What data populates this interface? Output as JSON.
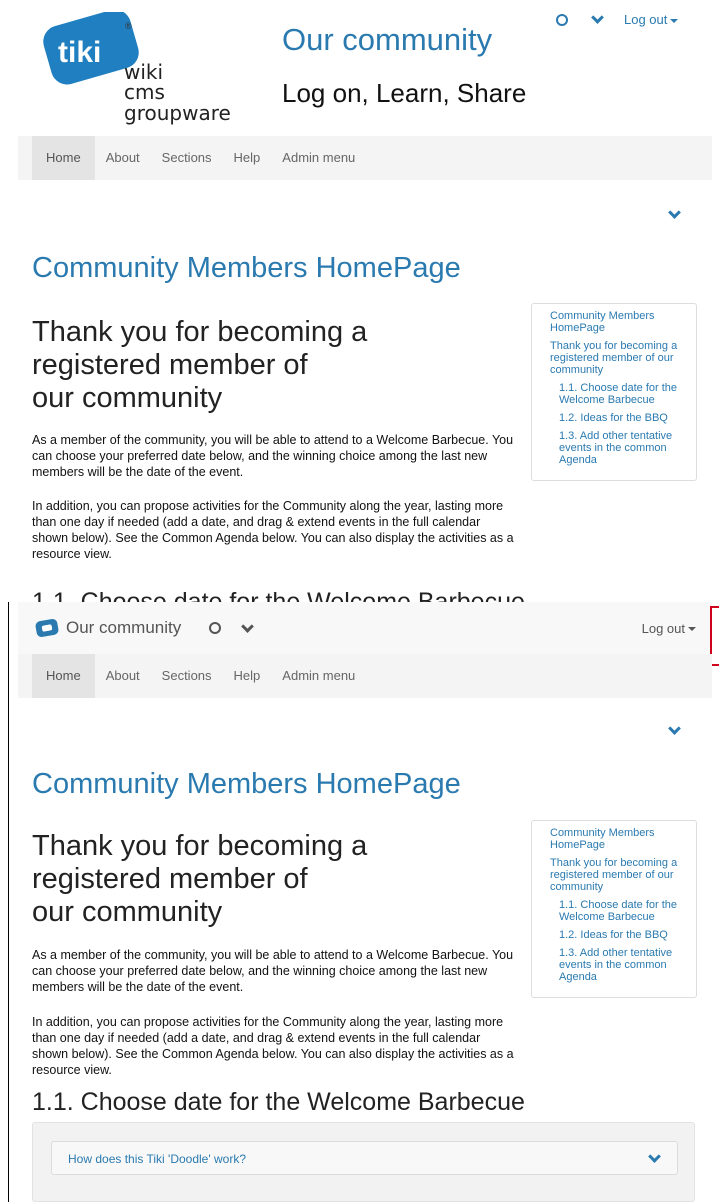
{
  "site": {
    "title": "Our community",
    "slogan": "Log on, Learn, Share",
    "logo": {
      "brand": "tiki",
      "line1": "wiki",
      "line2": "cms",
      "line3": "groupware",
      "mark": "®"
    }
  },
  "topbar": {
    "logout_label": "Log out",
    "icons": [
      "clock-icon",
      "chevron-down-icon",
      "caret-icon"
    ]
  },
  "nav": {
    "items": [
      "Home",
      "About",
      "Sections",
      "Help",
      "Admin menu"
    ],
    "active": "Home"
  },
  "page": {
    "title": "Community Members HomePage",
    "heading_line1": "Thank you for becoming a",
    "heading_line2": "registered member of",
    "heading_line3": "our community",
    "para1": "As a member of the community, you will be able to attend to a Welcome Barbecue. You can choose your preferred date below, and the winning choice among the last new members will be the date of the event.",
    "para2": "In addition, you can propose activities for the Community along the year, lasting more than one day if needed (add a date, and drag & extend events in the full calendar shown below). See the Common Agenda below. You can also display the activities as a resource view.",
    "section_1_1": "1.1. Choose date for the Welcome Barbecue"
  },
  "toc": {
    "items": [
      {
        "level": 1,
        "text": "Community Members HomePage"
      },
      {
        "level": 1,
        "text": "Thank you for becoming a registered member of our community"
      },
      {
        "level": 2,
        "text": "1.1. Choose date for the Welcome Barbecue"
      },
      {
        "level": 2,
        "text": "1.2. Ideas for the BBQ"
      },
      {
        "level": 2,
        "text": "1.3. Add other tentative events in the common Agenda"
      }
    ]
  },
  "fixed_bar": {
    "title": "Our community",
    "logout_label": "Log out"
  },
  "accordion": {
    "title": "How does this Tiki 'Doodle' work?"
  },
  "colors": {
    "link": "#2a7ab0",
    "navbar_bg": "#f4f4f4",
    "active_nav": "#e4e4e4"
  }
}
